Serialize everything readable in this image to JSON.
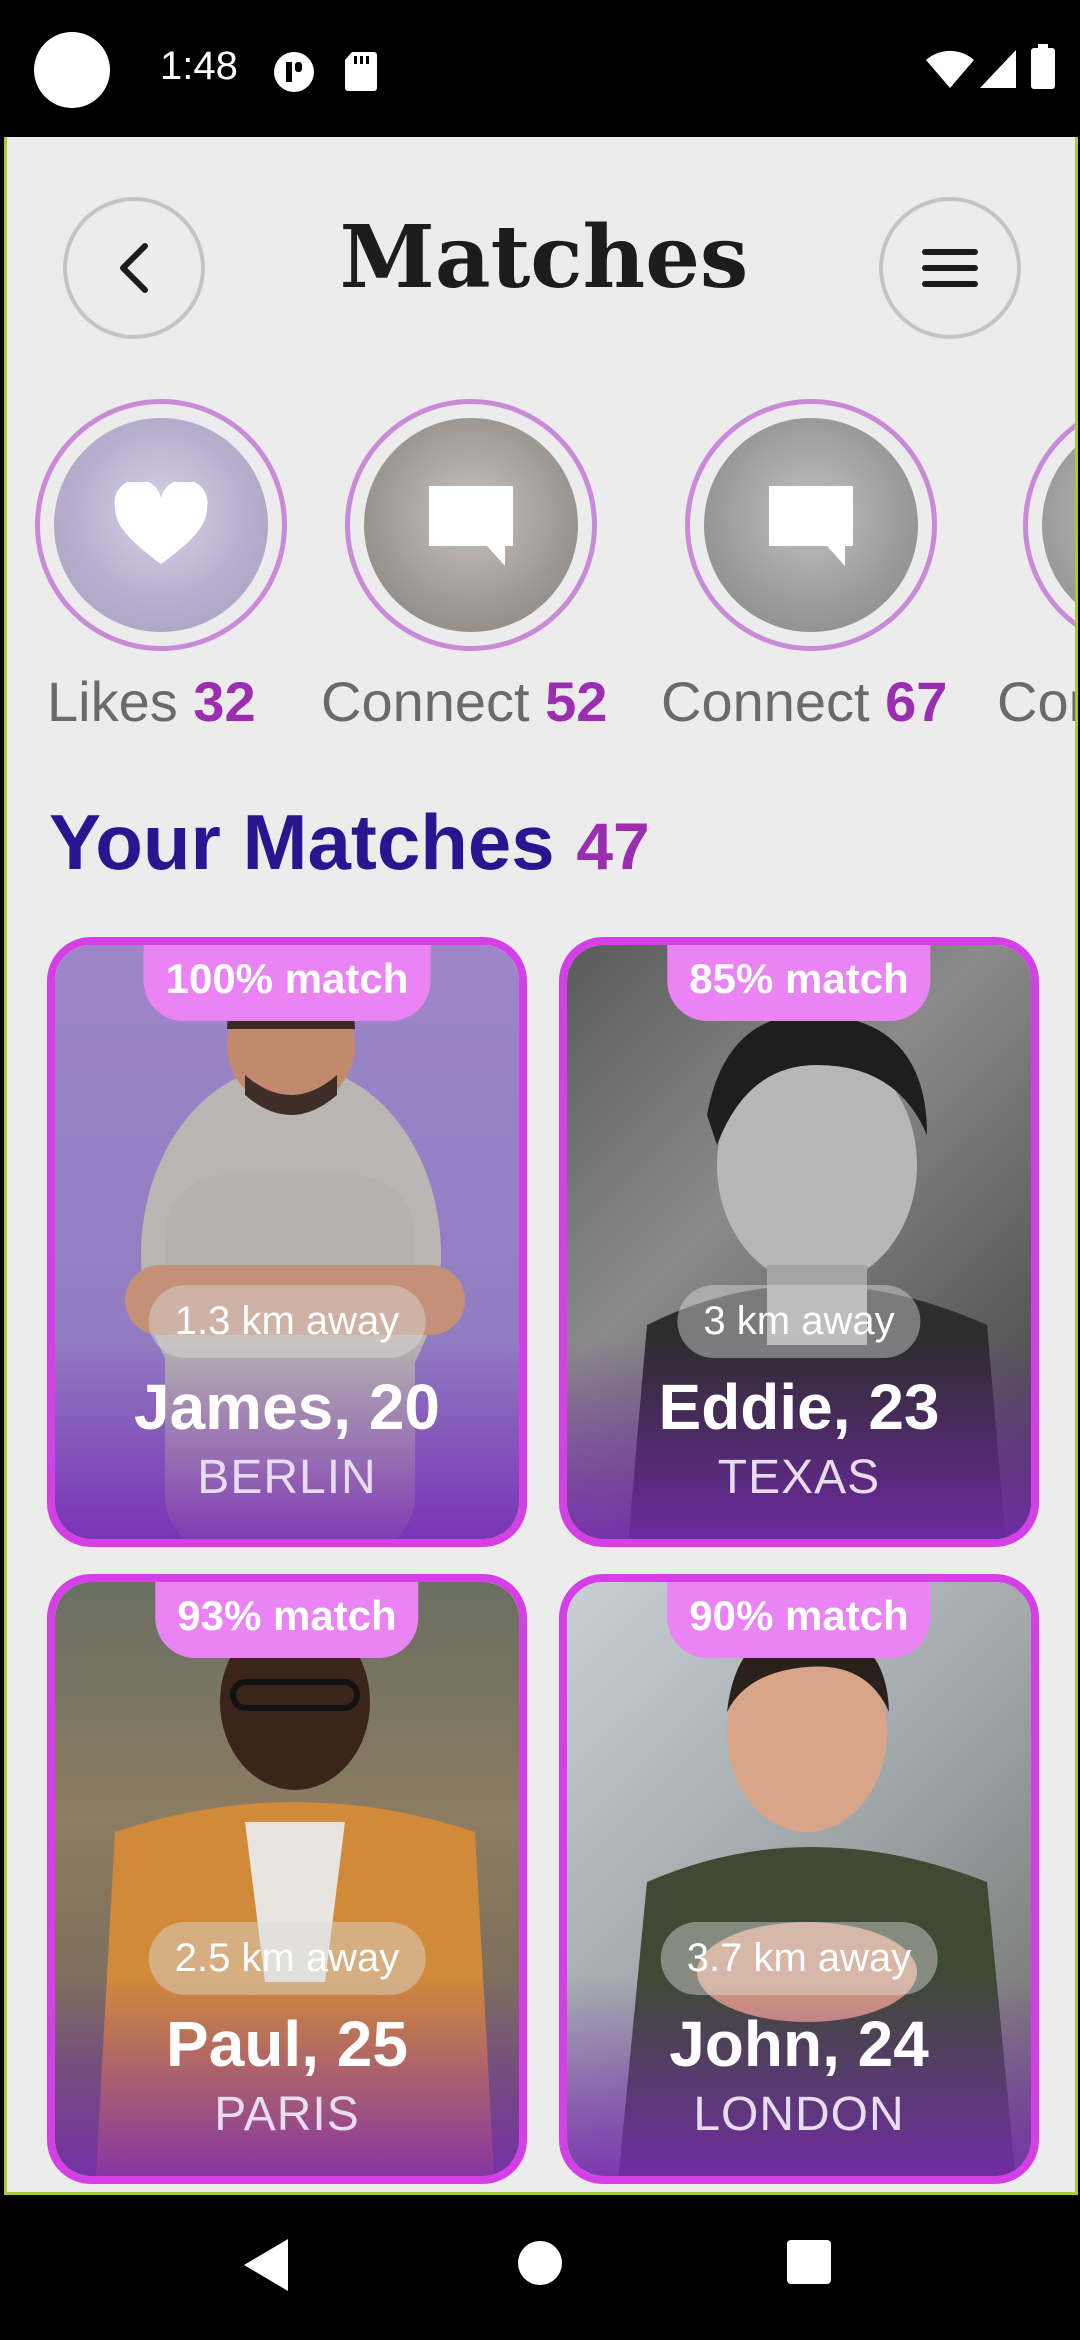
{
  "status_bar": {
    "time": "1:48"
  },
  "header": {
    "title": "Matches"
  },
  "stories": [
    {
      "label": "Likes",
      "count": "32",
      "icon": "heart-icon"
    },
    {
      "label": "Connect",
      "count": "52",
      "icon": "chat-bubble-icon"
    },
    {
      "label": "Connect",
      "count": "67",
      "icon": "chat-bubble-icon"
    },
    {
      "label": "Connect",
      "count": "",
      "icon": ""
    }
  ],
  "matches_section": {
    "title": "Your Matches",
    "count": "47"
  },
  "cards": [
    {
      "match": "100% match",
      "distance": "1.3 km away",
      "name": "James, 20",
      "city": "BERLIN"
    },
    {
      "match": "85% match",
      "distance": "3 km away",
      "name": "Eddie, 23",
      "city": "TEXAS"
    },
    {
      "match": "93% match",
      "distance": "2.5 km away",
      "name": "Paul, 25",
      "city": "PARIS"
    },
    {
      "match": "90% match",
      "distance": "3.7 km away",
      "name": "John, 24",
      "city": "LONDON"
    }
  ],
  "colors": {
    "accent": "#d440e6",
    "title_purple": "#2a1590",
    "count_purple": "#9a2db0",
    "match_tab": "#ea84f5"
  }
}
